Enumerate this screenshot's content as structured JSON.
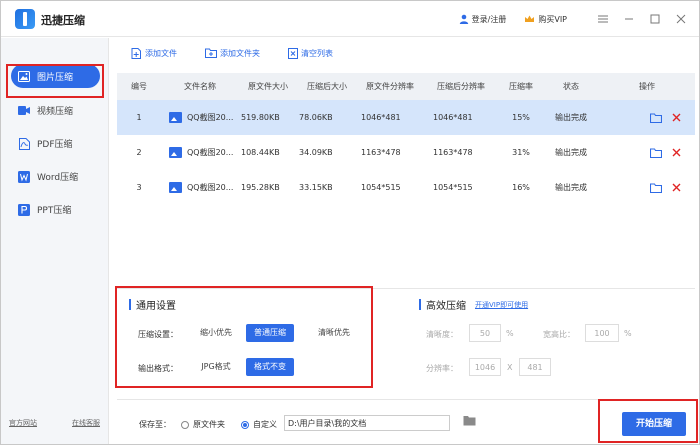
{
  "app": {
    "title": "迅捷压缩"
  },
  "header": {
    "login_label": "登录/注册",
    "vip_label": "购买VIP"
  },
  "sidebar": {
    "items": [
      {
        "label": "图片压缩",
        "icon": "image-icon",
        "active": true
      },
      {
        "label": "视频压缩",
        "icon": "video-icon"
      },
      {
        "label": "PDF压缩",
        "icon": "pdf-icon"
      },
      {
        "label": "Word压缩",
        "icon": "word-icon"
      },
      {
        "label": "PPT压缩",
        "icon": "ppt-icon"
      }
    ],
    "footer": {
      "site": "官方网站",
      "service": "在线客服"
    }
  },
  "toolbar": {
    "add_file": "添加文件",
    "add_folder": "添加文件夹",
    "clear_list": "清空列表"
  },
  "table": {
    "headers": [
      "编号",
      "文件名称",
      "原文件大小",
      "压缩后大小",
      "原文件分辨率",
      "压缩后分辨率",
      "压缩率",
      "状态",
      "操作"
    ],
    "rows": [
      {
        "no": "1",
        "name": "QQ截图20...",
        "orig_size": "519.80KB",
        "new_size": "78.06KB",
        "orig_res": "1046*481",
        "new_res": "1046*481",
        "rate": "15%",
        "status": "输出完成"
      },
      {
        "no": "2",
        "name": "QQ截图20...",
        "orig_size": "108.44KB",
        "new_size": "34.09KB",
        "orig_res": "1163*478",
        "new_res": "1163*478",
        "rate": "31%",
        "status": "输出完成"
      },
      {
        "no": "3",
        "name": "QQ截图20...",
        "orig_size": "195.28KB",
        "new_size": "33.15KB",
        "orig_res": "1054*515",
        "new_res": "1054*515",
        "rate": "16%",
        "status": "输出完成"
      }
    ]
  },
  "general": {
    "title": "通用设置",
    "mode_label": "压缩设置：",
    "modes": [
      "缩小优先",
      "普通压缩",
      "清晰优先"
    ],
    "format_label": "输出格式：",
    "formats": [
      "JPG格式",
      "格式不变"
    ]
  },
  "efficient": {
    "title": "高效压缩",
    "vip_link": "开通VIP即可使用",
    "clarity_label": "清晰度：",
    "clarity_value": "50",
    "clarity_unit": "%",
    "width_label": "宽高比：",
    "width_value": "100",
    "width_unit": "%",
    "res_label": "分辨率：",
    "res_w": "1046",
    "res_sep": "X",
    "res_h": "481"
  },
  "save": {
    "label": "保存至：",
    "opt_original": "原文件夹",
    "opt_custom": "自定义",
    "path": "D:\\用户目录\\我的文档",
    "start_label": "开始压缩"
  },
  "colors": {
    "accent": "#2e6be6",
    "selected_row": "#d5e5fb",
    "highlight": "#e02424"
  }
}
